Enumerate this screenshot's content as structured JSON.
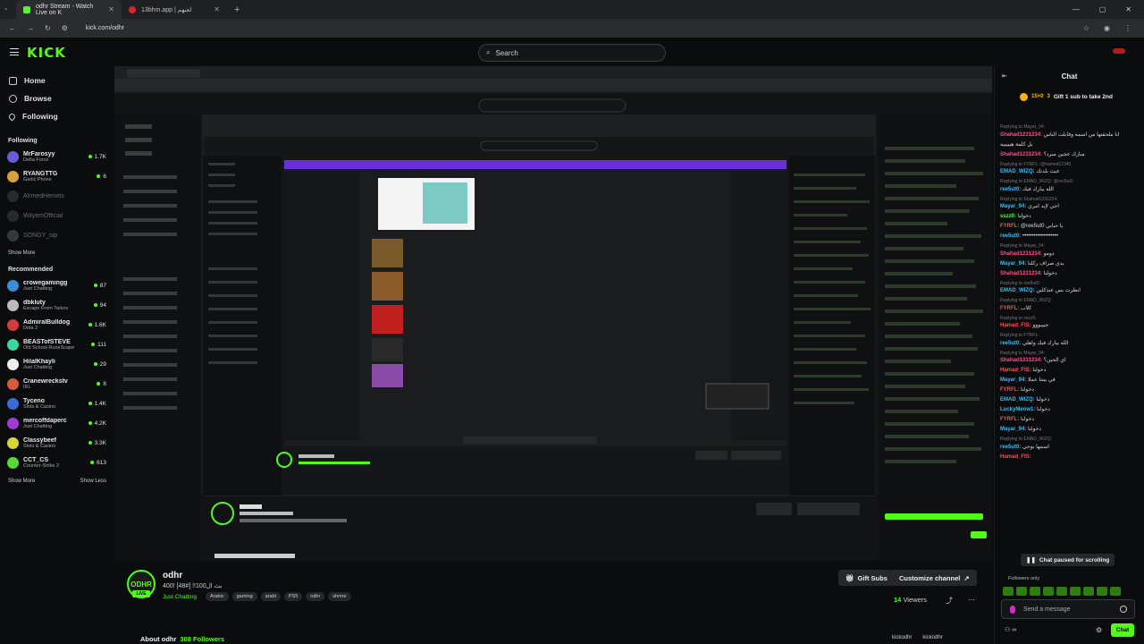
{
  "browser": {
    "tabs": [
      {
        "title": "odhr Stream - Watch Live on K",
        "active": true
      },
      {
        "title": "13bhm.app | لعبهم",
        "active": false
      }
    ],
    "url": "kick.com/odhr"
  },
  "topnav": {
    "logo": "KICK",
    "search_placeholder": "Search"
  },
  "sidebar": {
    "nav": [
      {
        "label": "Home",
        "icon": "home-icon"
      },
      {
        "label": "Browse",
        "icon": "compass-icon"
      },
      {
        "label": "Following",
        "icon": "heart-icon"
      }
    ],
    "following_title": "Following",
    "following": [
      {
        "name": "MrFarosyy",
        "sub": "Delta Force",
        "viewers": "1.7K",
        "online": true
      },
      {
        "name": "RYANGTTG",
        "sub": "Garlic Phone",
        "viewers": "6",
        "online": true
      },
      {
        "name": "AhmedHemeis",
        "sub": "",
        "viewers": "",
        "online": false
      },
      {
        "name": "WilyemOfficial",
        "sub": "",
        "viewers": "",
        "online": false
      },
      {
        "name": "SONGY_sip",
        "sub": "",
        "viewers": "",
        "online": false
      }
    ],
    "show_more": "Show More",
    "recommended_title": "Recommended",
    "recommended": [
      {
        "name": "crowegamingg",
        "sub": "Just Chatting",
        "viewers": "87"
      },
      {
        "name": "dbkluty",
        "sub": "Escape From Tarkov",
        "viewers": "94"
      },
      {
        "name": "AdmiralBulldog",
        "sub": "Dota 2",
        "viewers": "1.6K"
      },
      {
        "name": "BEASTofSTEVE",
        "sub": "Old School RuneScape",
        "viewers": "111"
      },
      {
        "name": "HilalKhayli",
        "sub": "Just Chatting",
        "viewers": "29"
      },
      {
        "name": "Cranewreckstv",
        "sub": "IRL",
        "viewers": "8"
      },
      {
        "name": "Tyceno",
        "sub": "Slots & Casino",
        "viewers": "1.4K"
      },
      {
        "name": "mercoffdaperc",
        "sub": "Just Chatting",
        "viewers": "4.2K"
      },
      {
        "name": "Classybeef",
        "sub": "Slots & Casino",
        "viewers": "3.3K"
      },
      {
        "name": "CCT_CS",
        "sub": "Counter-Strike 2",
        "viewers": "613"
      }
    ],
    "show_more_2": "Show More",
    "show_less": "Show Less"
  },
  "stream": {
    "avatar_text": "ODHR",
    "live": "LIVE",
    "channel": "odhr",
    "title": "بث ال100!! [#48] !400",
    "category": "Just Chatting",
    "tags": [
      "Arabic",
      "gaming",
      "arabi",
      "PS5",
      "odhr",
      "shmre"
    ],
    "gift_subs": "Gift Subs",
    "customize": "Customize channel",
    "viewers": "14",
    "viewers_label": "Viewers",
    "about": "About odhr",
    "followers": "308 Followers",
    "social": [
      "kickodhr",
      "kickodhr"
    ]
  },
  "chat": {
    "title": "Chat",
    "pinned_count": "15×0",
    "pinned_sub": "3",
    "pinned_text": "Gift 1 sub to take 2nd",
    "messages": [
      {
        "reply": "Replying to Mayar_94:",
        "user": "Shahad1231234:",
        "text": "انا ملحقتها من اسمه وقابلت الناس",
        "color": "#ff4d8a"
      },
      {
        "reply": "",
        "user": "",
        "text": "بل كلمة هيييييه",
        "color": "#ff4d8a"
      },
      {
        "reply": "",
        "user": "Shahad1231234:",
        "text": "مبارك عجين مبرد؟",
        "color": "#ff4d8a"
      },
      {
        "reply": "Replying to FYRFL: @hamed12345",
        "user": "EMAD_WIZQ:",
        "text": "غيث بلدنك",
        "color": "#38bdf8"
      },
      {
        "reply": "Replying to EMAD_WIZQ: @ree5ut0",
        "user": "ree5ut0:",
        "text": "الله يبارك فيك",
        "color": "#38bdf8"
      },
      {
        "reply": "Replying to Shahad1231234:",
        "user": "Mayar_94:",
        "text": "اجي لإيد امري",
        "color": "#38bdf8"
      },
      {
        "reply": "",
        "user": "sszz0:",
        "text": "دخولنا",
        "color": "#53fc18"
      },
      {
        "reply": "",
        "user": "FYRFL:",
        "text": "@ree5ut0 يا حبابي",
        "color": "#ff4d4d"
      },
      {
        "reply": "",
        "user": "ree5ut0:",
        "text": "•••••••••••••••••••",
        "color": "#38bdf8"
      },
      {
        "reply": "Replying to Mayar_94:",
        "user": "Shahad1231234:",
        "text": "دومو",
        "color": "#ff4d8a"
      },
      {
        "reply": "",
        "user": "Mayar_94:",
        "text": "يدي صراف ركلنا",
        "color": "#38bdf8"
      },
      {
        "reply": "",
        "user": "Shahad1231234:",
        "text": "دخولنا",
        "color": "#ff4d8a"
      },
      {
        "reply": "Replying to ree5ut0:",
        "user": "EMAD_WIZQ:",
        "text": "انظرت بس عندكلين",
        "color": "#38bdf8"
      },
      {
        "reply": "Replying to EMAD_WIZQ:",
        "user": "FYRFL:",
        "text": "كلاب",
        "color": "#ff4d4d"
      },
      {
        "reply": "Replying to sszz0:",
        "user": "Hamad_FIS:",
        "text": "حبيبووو",
        "color": "#ff4d4d"
      },
      {
        "reply": "Replying to FYRFL:",
        "user": "ree5ut0:",
        "text": "الله يبارك فيك واهلي",
        "color": "#38bdf8"
      },
      {
        "reply": "Replying to Mayar_94:",
        "user": "Shahad1231234:",
        "text": "اي الحين؟",
        "color": "#ff4d8a"
      },
      {
        "reply": "",
        "user": "Hamad_FIS:",
        "text": "دخولنا",
        "color": "#ff4d4d"
      },
      {
        "reply": "",
        "user": "Mayar_94:",
        "text": "في بيتنا عملا",
        "color": "#38bdf8"
      },
      {
        "reply": "",
        "user": "FYRFL:",
        "text": "دخولنا",
        "color": "#ff4d4d"
      },
      {
        "reply": "",
        "user": "EMAD_WIZQ:",
        "text": "دخولنا",
        "color": "#38bdf8"
      },
      {
        "reply": "",
        "user": "LuckyMeow1:",
        "text": "دخولنا",
        "color": "#38bdf8"
      },
      {
        "reply": "",
        "user": "FYRFL:",
        "text": "دخولنا",
        "color": "#ff4d4d"
      },
      {
        "reply": "",
        "user": "Mayar_94:",
        "text": "دخولنا",
        "color": "#38bdf8"
      },
      {
        "reply": "Replying to EMAD_WIZQ:",
        "user": "ree5ut0:",
        "text": "اسمها بوجي",
        "color": "#38bdf8"
      },
      {
        "reply": "",
        "user": "Hamad_FIS:",
        "text": "",
        "color": "#ff4d4d"
      }
    ],
    "paused": "Chat paused for scrolling",
    "followers_only": "Followers only",
    "placeholder": "Send a message",
    "send": "Chat"
  },
  "colors": {
    "accent": "#53fc18",
    "background": "#0b0c0e",
    "panel": "#26272b"
  }
}
